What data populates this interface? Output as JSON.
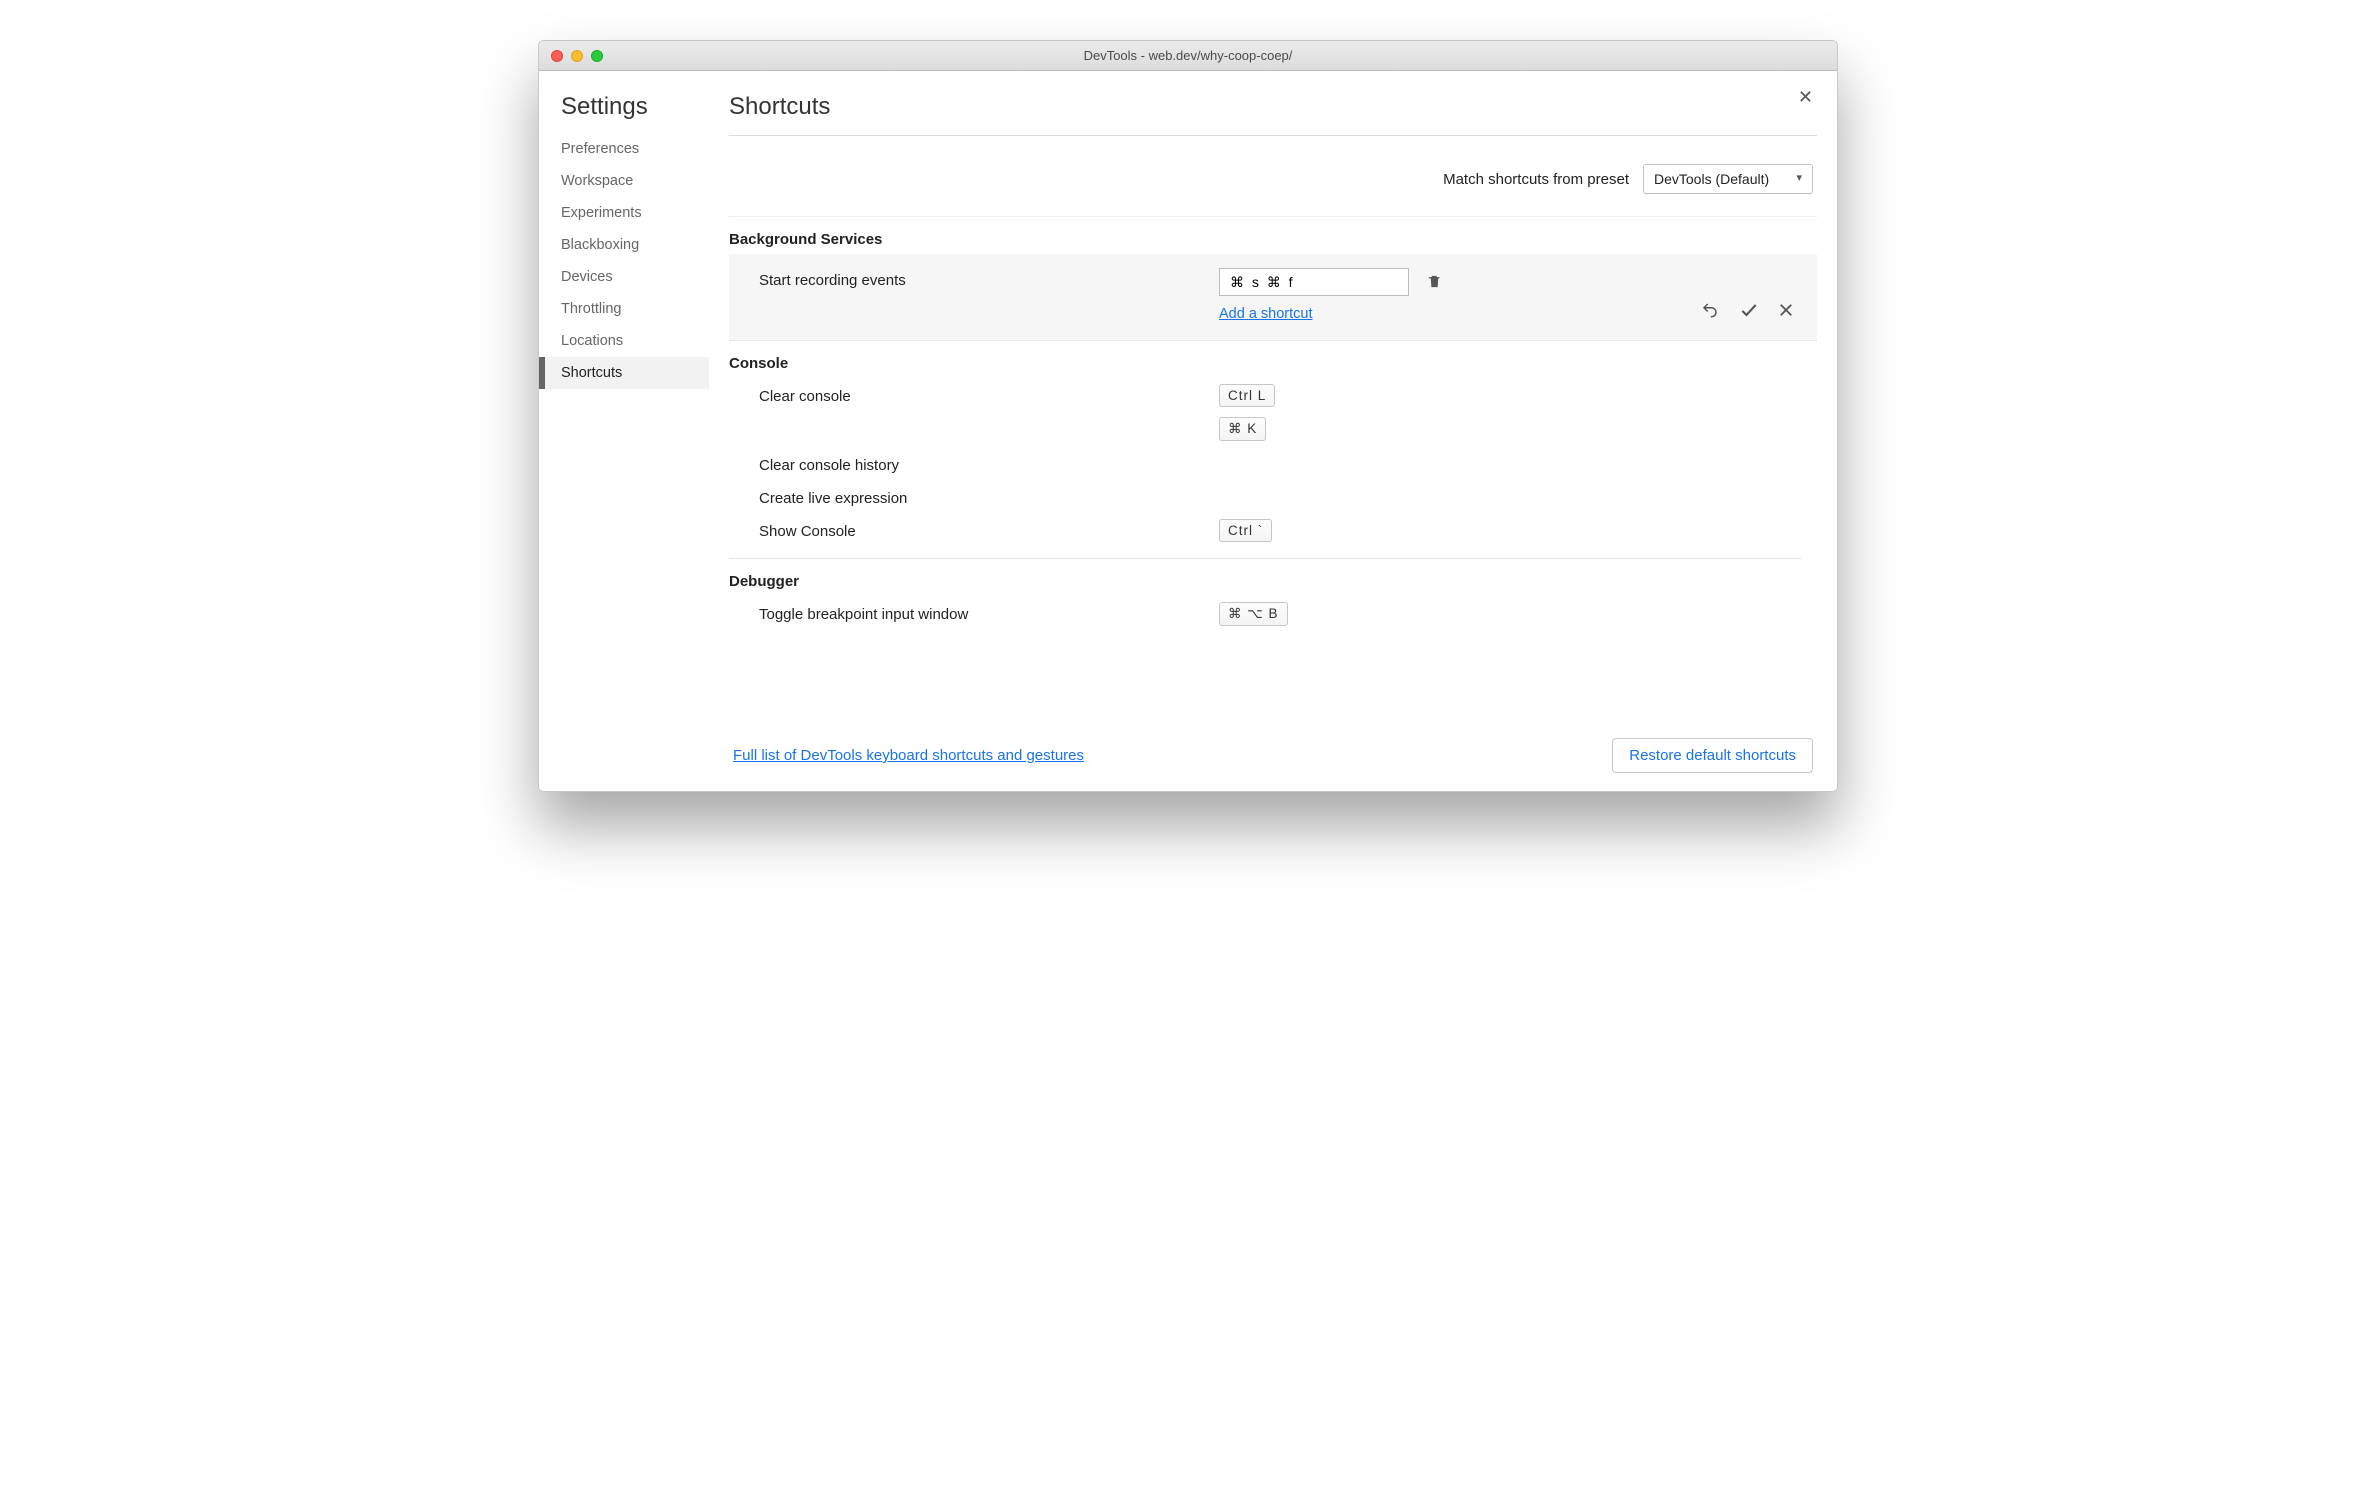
{
  "window": {
    "title": "DevTools - web.dev/why-coop-coep/"
  },
  "sidebar": {
    "heading": "Settings",
    "items": [
      {
        "label": "Preferences"
      },
      {
        "label": "Workspace"
      },
      {
        "label": "Experiments"
      },
      {
        "label": "Blackboxing"
      },
      {
        "label": "Devices"
      },
      {
        "label": "Throttling"
      },
      {
        "label": "Locations"
      },
      {
        "label": "Shortcuts"
      }
    ]
  },
  "page": {
    "title": "Shortcuts",
    "preset_label": "Match shortcuts from preset",
    "preset_value": "DevTools (Default)",
    "add_shortcut": "Add a shortcut",
    "full_list_link": "Full list of DevTools keyboard shortcuts and gestures",
    "restore_button": "Restore default shortcuts"
  },
  "sections": {
    "background": {
      "title": "Background Services",
      "start_recording": "Start recording events",
      "editing_value": "⌘ s ⌘ f"
    },
    "console": {
      "title": "Console",
      "clear_console": "Clear console",
      "clear_console_k1": "Ctrl L",
      "clear_console_k2": "⌘ K",
      "clear_history": "Clear console history",
      "create_live": "Create live expression",
      "show_console": "Show Console",
      "show_console_k": "Ctrl `"
    },
    "debugger": {
      "title": "Debugger",
      "toggle_bp": "Toggle breakpoint input window",
      "toggle_bp_k": "⌘ ⌥ B"
    }
  }
}
